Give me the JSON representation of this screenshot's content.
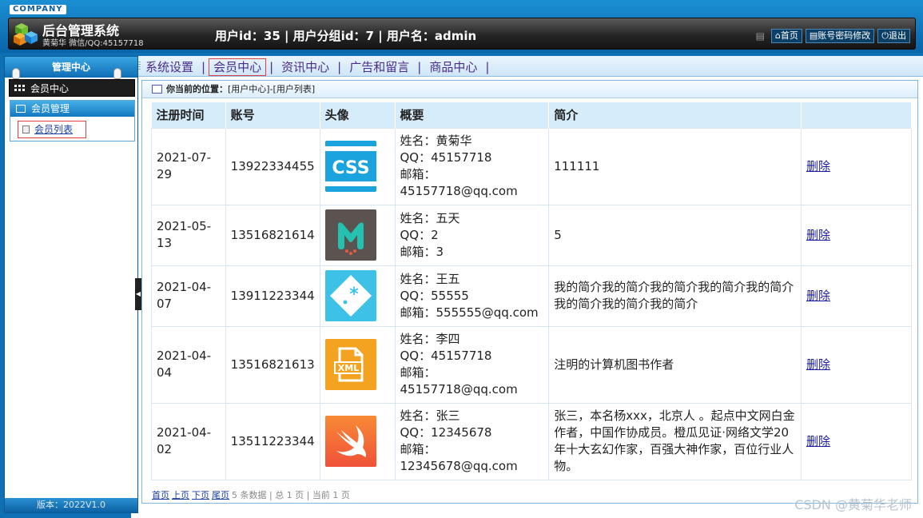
{
  "header": {
    "company": "COMPANY",
    "title": "后台管理系统",
    "subtitle": "黄菊华 微信/QQ:45157718",
    "userinfo": "用户id：35 | 用户分组id：7 | 用户名：admin",
    "buttons": {
      "home": "首页",
      "password": "账号密码修改",
      "logout": "退出"
    }
  },
  "sidebar": {
    "title": "管理中心",
    "item": "会员中心",
    "group": "会员管理",
    "link": "会员列表",
    "version": "版本：2022V1.0"
  },
  "nav": {
    "items": [
      "系统设置",
      "会员中心",
      "资讯中心",
      "广告和留言",
      "商品中心"
    ],
    "active": "会员中心"
  },
  "breadcrumb": {
    "label": "你当前的位置：",
    "path": "[用户中心]-[用户列表]"
  },
  "table": {
    "headers": [
      "注册时间",
      "账号",
      "头像",
      "概要",
      "简介",
      ""
    ],
    "rows": [
      {
        "date": "2021-07-29",
        "account": "13922334455",
        "avatar": "css-icon",
        "name": "姓名：黄菊华",
        "qq": "QQ：45157718",
        "email_label": "邮箱：",
        "email": "45157718@qq.com",
        "intro": "111111",
        "action": "删除"
      },
      {
        "date": "2021-05-13",
        "account": "13516821614",
        "avatar": "meteor-m-icon",
        "name": "姓名：五天",
        "qq": "QQ：2",
        "email_label": "邮箱：",
        "email": "3",
        "intro": "5",
        "action": "删除"
      },
      {
        "date": "2021-04-07",
        "account": "13911223344",
        "avatar": "regex-icon",
        "name": "姓名：王五",
        "qq": "QQ：55555",
        "email_label": "邮箱：",
        "email": "555555@qq.com",
        "intro": "我的简介我的简介我的简介我的简介我的简介我的简介我的简介我的简介",
        "action": "删除"
      },
      {
        "date": "2021-04-04",
        "account": "13516821613",
        "avatar": "xml-file-icon",
        "name": "姓名：李四",
        "qq": "QQ：45157718",
        "email_label": "邮箱：",
        "email": "45157718@qq.com",
        "intro": "注明的计算机图书作者",
        "action": "删除"
      },
      {
        "date": "2021-04-02",
        "account": "13511223344",
        "avatar": "swift-icon",
        "name": "姓名：张三",
        "qq": "QQ：12345678",
        "email_label": "邮箱：",
        "email": "12345678@qq.com",
        "intro": "张三，本名杨xxx，北京人 。起点中文网白金作者，中国作协成员。橙瓜见证·网络文学20年十大玄幻作家，百强大神作家，百位行业人物。",
        "action": "删除"
      }
    ]
  },
  "pager": {
    "first": "首页",
    "prev": "上页",
    "next": "下页",
    "last": "尾页",
    "summary": "5 条数据 | 总 1 页 | 当前 1 页"
  },
  "watermark": "CSDN @黄菊华老师",
  "colors": {
    "accent": "#0f6fb4",
    "table_header": "#d6ecfa",
    "nav_text": "#4a2c8a"
  }
}
